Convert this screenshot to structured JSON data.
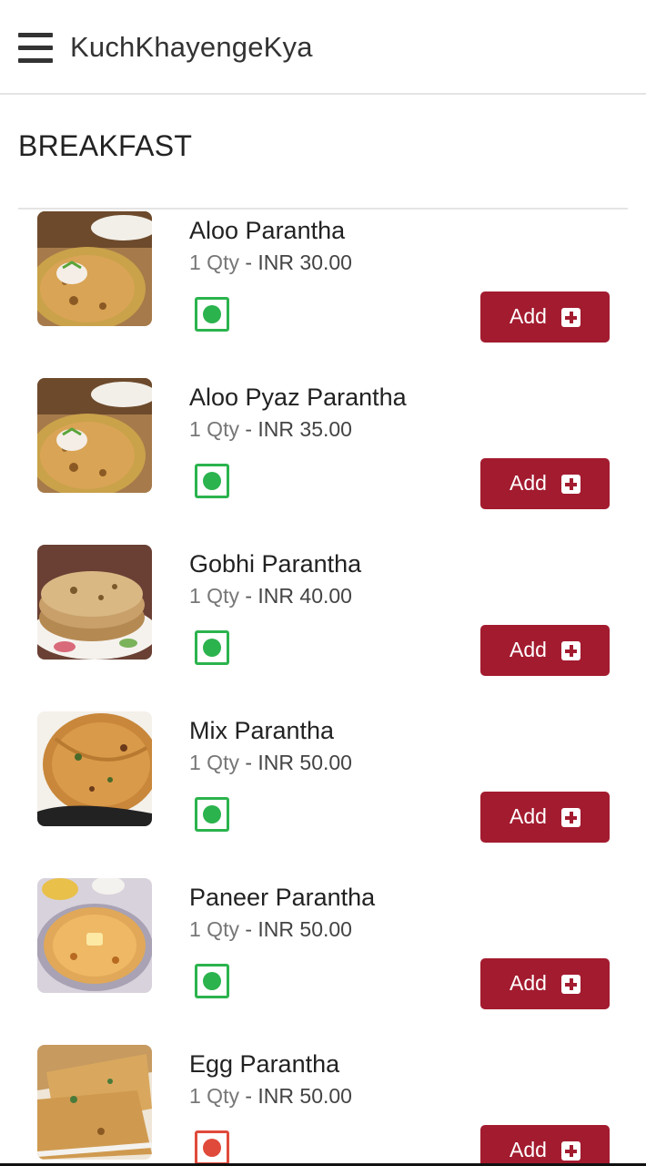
{
  "app": {
    "title": "KuchKhayengeKya"
  },
  "section": {
    "title": "BREAKFAST"
  },
  "colors": {
    "brand": "#a31b2f",
    "veg": "#2bb34d",
    "nonveg": "#e04a3a"
  },
  "items": [
    {
      "name": "Aloo Parantha",
      "qty": "1 Qty",
      "sep": " - ",
      "price": "INR 30.00",
      "type": "veg",
      "add_label": "Add",
      "image": "aloo-parantha-photo"
    },
    {
      "name": "Aloo Pyaz Parantha",
      "qty": "1 Qty",
      "sep": " - ",
      "price": "INR 35.00",
      "type": "veg",
      "add_label": "Add",
      "image": "aloo-pyaz-parantha-photo"
    },
    {
      "name": "Gobhi Parantha",
      "qty": "1 Qty",
      "sep": " - ",
      "price": "INR 40.00",
      "type": "veg",
      "add_label": "Add",
      "image": "gobhi-parantha-photo"
    },
    {
      "name": "Mix Parantha",
      "qty": "1 Qty",
      "sep": " - ",
      "price": "INR 50.00",
      "type": "veg",
      "add_label": "Add",
      "image": "mix-parantha-photo"
    },
    {
      "name": "Paneer Parantha",
      "qty": "1 Qty",
      "sep": " - ",
      "price": "INR 50.00",
      "type": "veg",
      "add_label": "Add",
      "image": "paneer-parantha-photo"
    },
    {
      "name": "Egg Parantha",
      "qty": "1 Qty",
      "sep": " - ",
      "price": "INR 50.00",
      "type": "nonveg",
      "add_label": "Add",
      "image": "egg-parantha-photo"
    }
  ]
}
